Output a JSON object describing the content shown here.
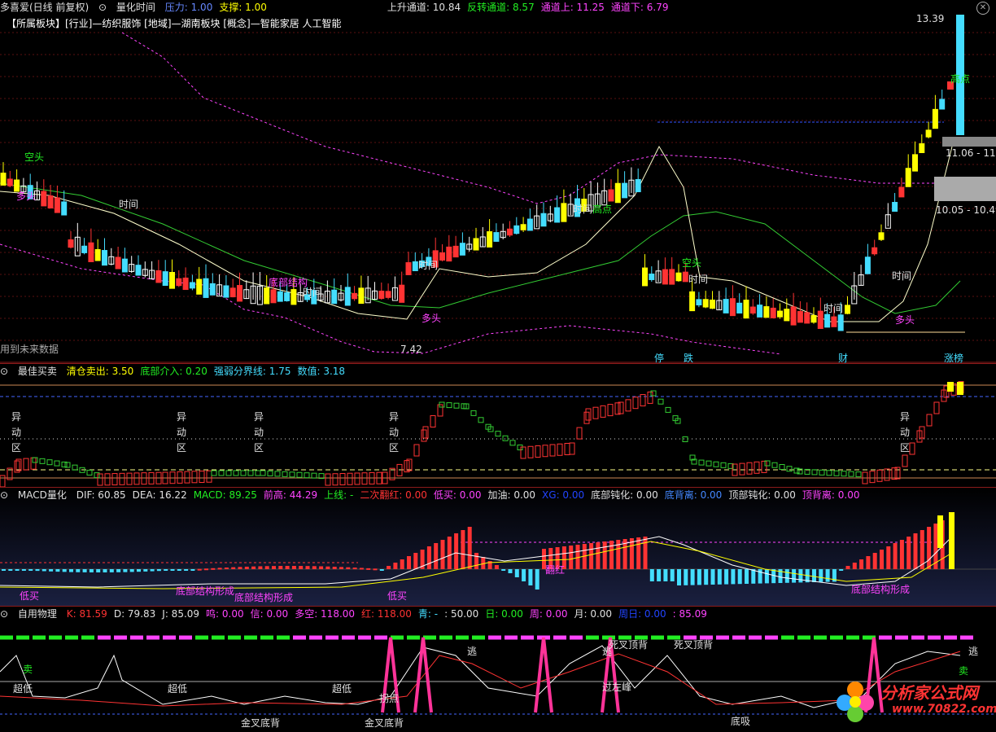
{
  "main": {
    "title": "多喜爱(日线 前复权)",
    "indicator": "量化时间",
    "params": [
      {
        "label": "压力: 1.00",
        "color": "#6688ff"
      },
      {
        "label": "支撑: 1.00",
        "color": "#ffff00"
      },
      {
        "label": "上升通道: 10.84",
        "color": "#e0e0e0"
      },
      {
        "label": "反转通道: 8.57",
        "color": "#22ee22"
      },
      {
        "label": "通道上: 11.25",
        "color": "#ff44ff"
      },
      {
        "label": "通道下: 6.79",
        "color": "#ff44ff"
      }
    ],
    "sector_line": "【所属板块】[行业]—纺织服饰 [地域]—湖南板块 [概念]—智能家居 人工智能",
    "price_high": "13.39",
    "price_low": "7.42",
    "price_box1": "11.06 - 11.",
    "price_box2": "10.05 - 10.49",
    "future_note": "用到未来数据",
    "labels": {
      "kongtou1": "空头",
      "duotou1": "多头",
      "time": "时间",
      "dibujiegou": "底部结构",
      "duotou2": "多头",
      "gaodian": "高点",
      "kongtou2": "空头",
      "duotou3": "多头",
      "gaodian2": "高点"
    },
    "bottom_tags": [
      "停",
      "跌",
      "财",
      "涨榜"
    ]
  },
  "panel2": {
    "title": "最佳买卖",
    "params": [
      {
        "label": "清仓卖出: 3.50",
        "color": "#ffff00"
      },
      {
        "label": "底部介入: 0.20",
        "color": "#22ee22"
      },
      {
        "label": "强弱分界线: 1.75",
        "color": "#44ddff"
      },
      {
        "label": "数值: 3.18",
        "color": "#44ddff"
      }
    ],
    "zone_chars": [
      "异",
      "动",
      "区"
    ]
  },
  "panel3": {
    "title": "MACD量化",
    "params": [
      {
        "label": "DIF: 60.85",
        "color": "#e0e0e0"
      },
      {
        "label": "DEA: 16.22",
        "color": "#e0e0e0"
      },
      {
        "label": "MACD: 89.25",
        "color": "#22ee22"
      },
      {
        "label": "前高: 44.29",
        "color": "#ff44ff"
      },
      {
        "label": "上线: -",
        "color": "#22ee22"
      },
      {
        "label": "二次翻红: 0.00",
        "color": "#ff3333"
      },
      {
        "label": "低买: 0.00",
        "color": "#ff44ff"
      },
      {
        "label": "加油: 0.00",
        "color": "#e0e0e0"
      },
      {
        "label": "XG: 0.00",
        "color": "#2244ff"
      },
      {
        "label": "底部钝化: 0.00",
        "color": "#e0e0e0"
      },
      {
        "label": "底背离: 0.00",
        "color": "#4488ff"
      },
      {
        "label": "顶部钝化: 0.00",
        "color": "#e0e0e0"
      },
      {
        "label": "顶背离: 0.00",
        "color": "#ff44ff"
      }
    ],
    "labels": [
      "低买",
      "底部结构形成",
      "底部结构形成",
      "低买",
      "翻红",
      "底部结构形成"
    ]
  },
  "panel4": {
    "title": "自用物理",
    "params": [
      {
        "label": "K: 81.59",
        "color": "#ff3333"
      },
      {
        "label": "D: 79.83",
        "color": "#e0e0e0"
      },
      {
        "label": "J: 85.09",
        "color": "#e0e0e0"
      },
      {
        "label": "鸣: 0.00",
        "color": "#ff44ff"
      },
      {
        "label": "信: 0.00",
        "color": "#ff44ff"
      },
      {
        "label": "多空: 118.00",
        "color": "#ff44ff"
      },
      {
        "label": "红: 118.00",
        "color": "#ff3333"
      },
      {
        "label": "青: -",
        "color": "#44ddff"
      },
      {
        "label": ": 50.00",
        "color": "#e0e0e0"
      },
      {
        "label": "日: 0.00",
        "color": "#22ee22"
      },
      {
        "label": "周: 0.00",
        "color": "#ff44ff"
      },
      {
        "label": "月: 0.00",
        "color": "#e0e0e0"
      },
      {
        "label": "周日: 0.00",
        "color": "#2244ff"
      },
      {
        "label": ": 85.09",
        "color": "#ff44ff"
      }
    ],
    "labels": [
      "超低",
      "超低",
      "超低",
      "卖",
      "金叉底背",
      "金叉底背",
      "拐点",
      "逃",
      "逃",
      "逃",
      "过左峰",
      "死叉顶背",
      "死叉顶背",
      "底吸",
      "卖"
    ]
  },
  "watermark": {
    "brand": "分析家公式网",
    "url": "www.70822.com"
  }
}
